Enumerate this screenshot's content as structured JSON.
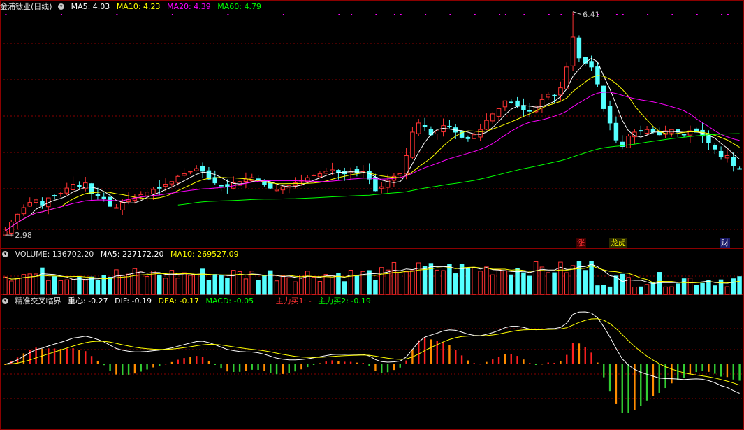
{
  "colors": {
    "up": "#ff3232",
    "down": "#54ffff",
    "ma5": "#ffffff",
    "ma10": "#ffff00",
    "ma20": "#ff00ff",
    "ma60": "#00ff00",
    "grid": "#8b0000",
    "macd_dif": "#ffffff",
    "macd_dea": "#ffff00",
    "ma_vol5": "#ffffff",
    "ma_vol10": "#ffff00"
  },
  "price_header": {
    "title": "金浦钛业(日线)",
    "ma5": "MA5: 4.03",
    "ma10": "MA10: 4.23",
    "ma20": "MA20: 4.39",
    "ma60": "MA60: 4.79"
  },
  "volume_header": {
    "label": "VOLUME: 136702.20",
    "ma5": "MA5: 227172.20",
    "ma10": "MA10: 269527.09"
  },
  "macd_header": {
    "title": "精准交叉临界",
    "zhongxin": "重心: -0.27",
    "dif": "DIF: -0.19",
    "dea": "DEA: -0.17",
    "macd": "MACD: -0.05",
    "buy1": "主力买1: -",
    "buy2": "主力买2: -0.19"
  },
  "markers": {
    "zhang": "涨",
    "longhu": "龙虎",
    "cai": "财"
  },
  "chart_data": [
    {
      "type": "candlestick",
      "title": "金浦钛业(日线)",
      "y_range": [
        2.98,
        6.41
      ],
      "annotations": {
        "high": "6.41",
        "low": "2.98"
      },
      "series_info": [
        "MA5",
        "MA10",
        "MA20",
        "MA60"
      ],
      "closes": [
        3.04,
        3.18,
        3.3,
        3.4,
        3.48,
        3.52,
        3.44,
        3.55,
        3.58,
        3.62,
        3.7,
        3.76,
        3.72,
        3.78,
        3.62,
        3.58,
        3.54,
        3.42,
        3.4,
        3.48,
        3.52,
        3.55,
        3.6,
        3.64,
        3.68,
        3.7,
        3.76,
        3.8,
        3.88,
        3.92,
        3.96,
        4.0,
        3.96,
        3.84,
        3.78,
        3.74,
        3.72,
        3.78,
        3.8,
        3.84,
        3.86,
        3.82,
        3.76,
        3.7,
        3.68,
        3.72,
        3.74,
        3.78,
        3.82,
        3.86,
        3.9,
        3.92,
        3.96,
        3.98,
        3.94,
        3.92,
        3.96,
        3.94,
        3.96,
        3.84,
        3.66,
        3.72,
        3.82,
        3.88,
        3.92,
        4.2,
        4.56,
        4.7,
        4.64,
        4.52,
        4.58,
        4.66,
        4.64,
        4.56,
        4.48,
        4.46,
        4.52,
        4.6,
        4.74,
        4.84,
        4.92,
        5.04,
        5.02,
        4.96,
        4.9,
        4.88,
        4.96,
        5.06,
        5.14,
        5.12,
        5.24,
        5.56,
        6.02,
        5.7,
        5.62,
        5.56,
        5.3,
        4.92,
        4.7,
        4.44,
        4.34,
        4.5,
        4.56,
        4.58,
        4.6,
        4.56,
        4.52,
        4.58,
        4.6,
        4.56,
        4.52,
        4.58,
        4.56,
        4.5,
        4.4,
        4.3,
        4.18,
        4.2,
        4.04,
        4.0
      ]
    },
    {
      "type": "bar",
      "title": "VOLUME",
      "ma5": 227172.2,
      "ma10": 269527.09,
      "last": 136702.2
    },
    {
      "type": "bar",
      "title": "精准交叉临界",
      "series": [
        {
          "name": "DIF",
          "last": -0.19
        },
        {
          "name": "DEA",
          "last": -0.17
        },
        {
          "name": "MACD",
          "last": -0.05
        }
      ]
    }
  ]
}
